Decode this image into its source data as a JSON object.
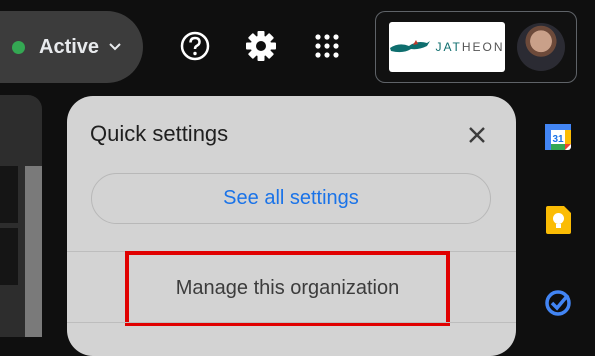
{
  "status": {
    "label": "Active",
    "color": "#34a853"
  },
  "header_icons": [
    "help-icon",
    "settings-icon",
    "apps-grid-icon"
  ],
  "account": {
    "logo_text_a": "JAT",
    "logo_text_b": "HEON",
    "brand_color": "#0e6e6e"
  },
  "quick_settings": {
    "title": "Quick settings",
    "see_all_label": "See all settings",
    "manage_label": "Manage this organization",
    "link_color": "#1a73e8",
    "highlight_color": "#e00000"
  },
  "side_apps": [
    {
      "icon": "calendar-icon",
      "label": "31"
    },
    {
      "icon": "keep-icon"
    },
    {
      "icon": "tasks-icon"
    }
  ]
}
